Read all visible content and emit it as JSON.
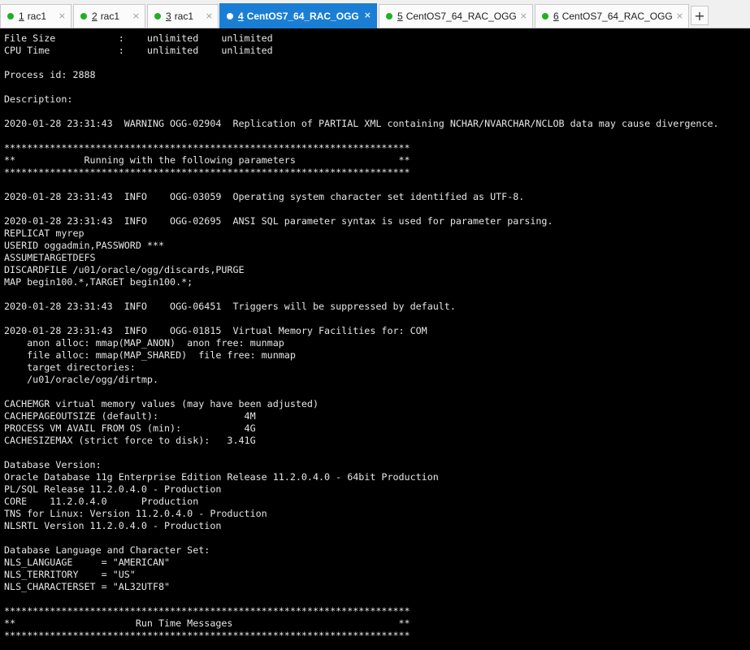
{
  "tabs": [
    {
      "number": "1",
      "label": "rac1",
      "active": false
    },
    {
      "number": "2",
      "label": "rac1",
      "active": false
    },
    {
      "number": "3",
      "label": "rac1",
      "active": false
    },
    {
      "number": "4",
      "label": "CentOS7_64_RAC_OGG",
      "active": true
    },
    {
      "number": "5",
      "label": "CentOS7_64_RAC_OGG",
      "active": false
    },
    {
      "number": "6",
      "label": "CentOS7_64_RAC_OGG",
      "active": false
    }
  ],
  "add_tab_label": "+",
  "close_glyph": "×",
  "colors": {
    "active_tab": "#1a7fd4",
    "status_dot": "#20b020",
    "terminal_bg": "#000000",
    "terminal_fg": "#e6e6e6"
  },
  "terminal": {
    "text": "File Size           :    unlimited    unlimited\nCPU Time            :    unlimited    unlimited\n\nProcess id: 2888\n\nDescription:\n\n2020-01-28 23:31:43  WARNING OGG-02904  Replication of PARTIAL XML containing NCHAR/NVARCHAR/NCLOB data may cause divergence.\n\n***********************************************************************\n**            Running with the following parameters                  **\n***********************************************************************\n\n2020-01-28 23:31:43  INFO    OGG-03059  Operating system character set identified as UTF-8.\n\n2020-01-28 23:31:43  INFO    OGG-02695  ANSI SQL parameter syntax is used for parameter parsing.\nREPLICAT myrep\nUSERID oggadmin,PASSWORD ***\nASSUMETARGETDEFS\nDISCARDFILE /u01/oracle/ogg/discards,PURGE\nMAP begin100.*,TARGET begin100.*;\n\n2020-01-28 23:31:43  INFO    OGG-06451  Triggers will be suppressed by default.\n\n2020-01-28 23:31:43  INFO    OGG-01815  Virtual Memory Facilities for: COM\n    anon alloc: mmap(MAP_ANON)  anon free: munmap\n    file alloc: mmap(MAP_SHARED)  file free: munmap\n    target directories:\n    /u01/oracle/ogg/dirtmp.\n\nCACHEMGR virtual memory values (may have been adjusted)\nCACHEPAGEOUTSIZE (default):               4M\nPROCESS VM AVAIL FROM OS (min):           4G\nCACHESIZEMAX (strict force to disk):   3.41G\n\nDatabase Version:\nOracle Database 11g Enterprise Edition Release 11.2.0.4.0 - 64bit Production\nPL/SQL Release 11.2.0.4.0 - Production\nCORE    11.2.0.4.0      Production\nTNS for Linux: Version 11.2.0.4.0 - Production\nNLSRTL Version 11.2.0.4.0 - Production\n\nDatabase Language and Character Set:\nNLS_LANGUAGE     = \"AMERICAN\"\nNLS_TERRITORY    = \"US\"\nNLS_CHARACTERSET = \"AL32UTF8\"\n\n***********************************************************************\n**                     Run Time Messages                             **\n***********************************************************************"
  }
}
